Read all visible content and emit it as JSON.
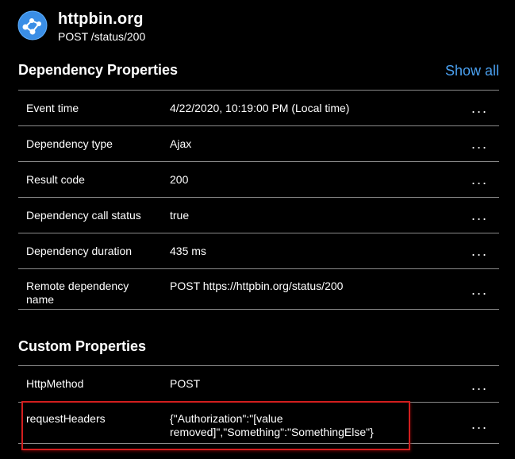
{
  "header": {
    "title": "httpbin.org",
    "subtitle": "POST /status/200",
    "icon": "application-insights-icon"
  },
  "dependency_properties": {
    "title": "Dependency Properties",
    "show_all_label": "Show all",
    "rows": [
      {
        "key": "Event time",
        "value": "4/22/2020, 10:19:00 PM (Local time)"
      },
      {
        "key": "Dependency type",
        "value": "Ajax"
      },
      {
        "key": "Result code",
        "value": "200"
      },
      {
        "key": "Dependency call status",
        "value": "true"
      },
      {
        "key": "Dependency duration",
        "value": "435 ms"
      },
      {
        "key": "Remote dependency name",
        "value": "POST https://httpbin.org/status/200"
      }
    ]
  },
  "custom_properties": {
    "title": "Custom Properties",
    "rows": [
      {
        "key": "HttpMethod",
        "value": "POST"
      },
      {
        "key": "requestHeaders",
        "value": "{\"Authorization\":\"[value removed]\",\"Something\":\"SomethingElse\"}"
      }
    ]
  },
  "more_label": "...",
  "colors": {
    "background": "#000000",
    "text": "#ffffff",
    "link": "#4aa0f0",
    "divider": "#8a8a8a",
    "highlight": "#d21e1e"
  }
}
